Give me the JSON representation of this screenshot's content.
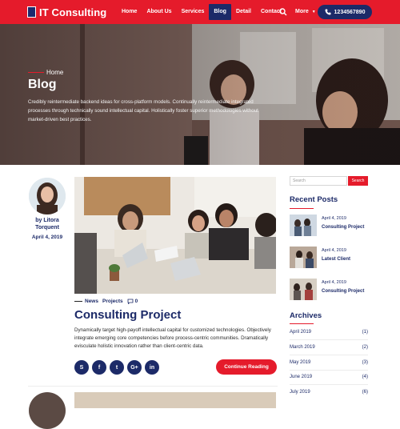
{
  "brand": {
    "name": "IT Consulting"
  },
  "nav": {
    "items": [
      {
        "label": "Home"
      },
      {
        "label": "About Us"
      },
      {
        "label": "Services"
      },
      {
        "label": "Blog"
      },
      {
        "label": "Detail"
      },
      {
        "label": "Contact"
      }
    ],
    "active": "Blog",
    "more_label": "More",
    "phone": "1234567890"
  },
  "hero": {
    "breadcrumb": "Home",
    "title": "Blog",
    "description": "Credibly reintermediate backend ideas for cross-platform models. Continually reintermediate integrated processes through technically sound intellectual capital. Holistically foster superior methodologies without market-driven best practices."
  },
  "post": {
    "author": "by Litora Torquent",
    "date": "April 4, 2019",
    "categories": [
      "News",
      "Projects"
    ],
    "comments": "0",
    "title": "Consulting Project",
    "excerpt": "Dynamically target high-payoff intellectual capital for customized technologies. Objectively integrate emerging core competencies before process-centric communities. Dramatically evisculate holistic innovation rather than client-centric data.",
    "continue_label": "Continue Reading",
    "socials": [
      {
        "glyph": "S",
        "icon": "skype-icon"
      },
      {
        "glyph": "f",
        "icon": "facebook-icon"
      },
      {
        "glyph": "t",
        "icon": "twitter-icon"
      },
      {
        "glyph": "G+",
        "icon": "google-plus-icon"
      },
      {
        "glyph": "in",
        "icon": "linkedin-icon"
      }
    ]
  },
  "sidebar": {
    "search_placeholder": "Search",
    "search_button": "Search",
    "recent_heading": "Recent Posts",
    "recent": [
      {
        "date": "April 4, 2019",
        "title": "Consulting Project"
      },
      {
        "date": "April 4, 2019",
        "title": "Latest Client"
      },
      {
        "date": "April 4, 2019",
        "title": "Consulting Project"
      }
    ],
    "archives_heading": "Archives",
    "archives": [
      {
        "month": "April 2019",
        "count": "(1)"
      },
      {
        "month": "March 2019",
        "count": "(2)"
      },
      {
        "month": "May 2019",
        "count": "(3)"
      },
      {
        "month": "June 2019",
        "count": "(4)"
      },
      {
        "month": "July 2019",
        "count": "(6)"
      }
    ]
  },
  "colors": {
    "primary": "#e51b2b",
    "navy": "#1c2a68"
  }
}
